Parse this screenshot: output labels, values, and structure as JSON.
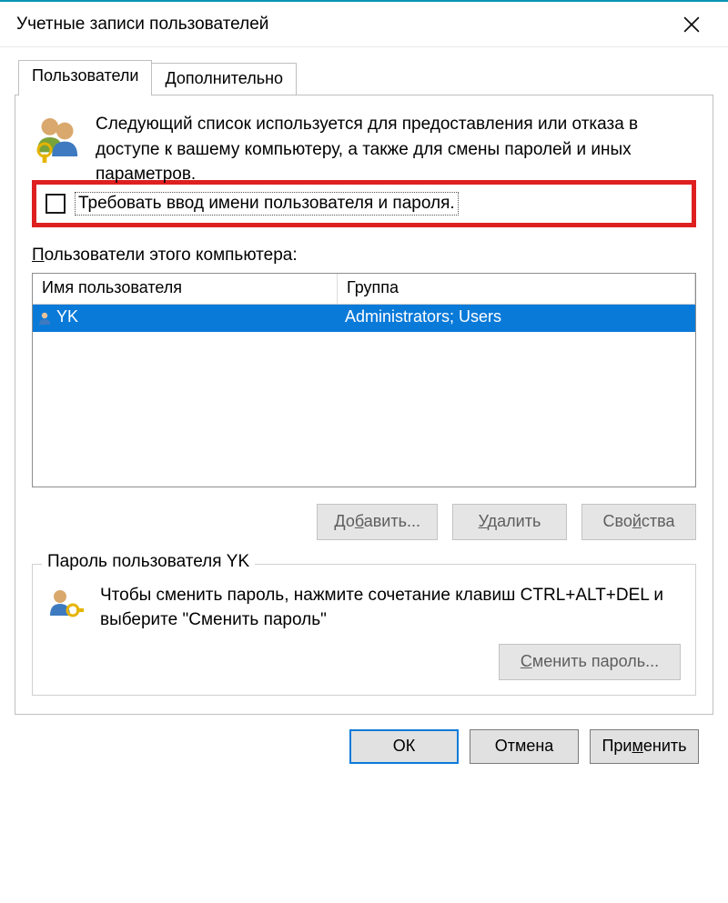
{
  "window": {
    "title": "Учетные записи пользователей"
  },
  "tabs": {
    "users": "Пользователи",
    "advanced": "Дополнительно"
  },
  "intro": "Следующий список используется для предоставления или отказа в доступе к вашему компьютеру, а также для смены паролей и иных параметров.",
  "require_checkbox": {
    "letter": "Т",
    "rest": "ребовать ввод имени пользователя и пароля."
  },
  "list_label": {
    "letter": "П",
    "rest": "ользователи этого компьютера:"
  },
  "columns": {
    "name": "Имя пользователя",
    "group": "Группа"
  },
  "rows": [
    {
      "name": "YK",
      "group": "Administrators; Users"
    }
  ],
  "buttons": {
    "add_pre": "До",
    "add_ul": "б",
    "add_post": "авить...",
    "remove_ul": "У",
    "remove_post": "далить",
    "props_pre": "Сво",
    "props_ul": "й",
    "props_post": "ства"
  },
  "password_group": {
    "legend": "Пароль пользователя YK",
    "text": "Чтобы сменить пароль, нажмите сочетание клавиш CTRL+ALT+DEL и выберите \"Сменить пароль\"",
    "btn_ul": "С",
    "btn_post": "менить пароль..."
  },
  "dlg_buttons": {
    "ok": "ОК",
    "cancel": "Отмена",
    "apply_pre": "При",
    "apply_ul": "м",
    "apply_post": "енить"
  }
}
